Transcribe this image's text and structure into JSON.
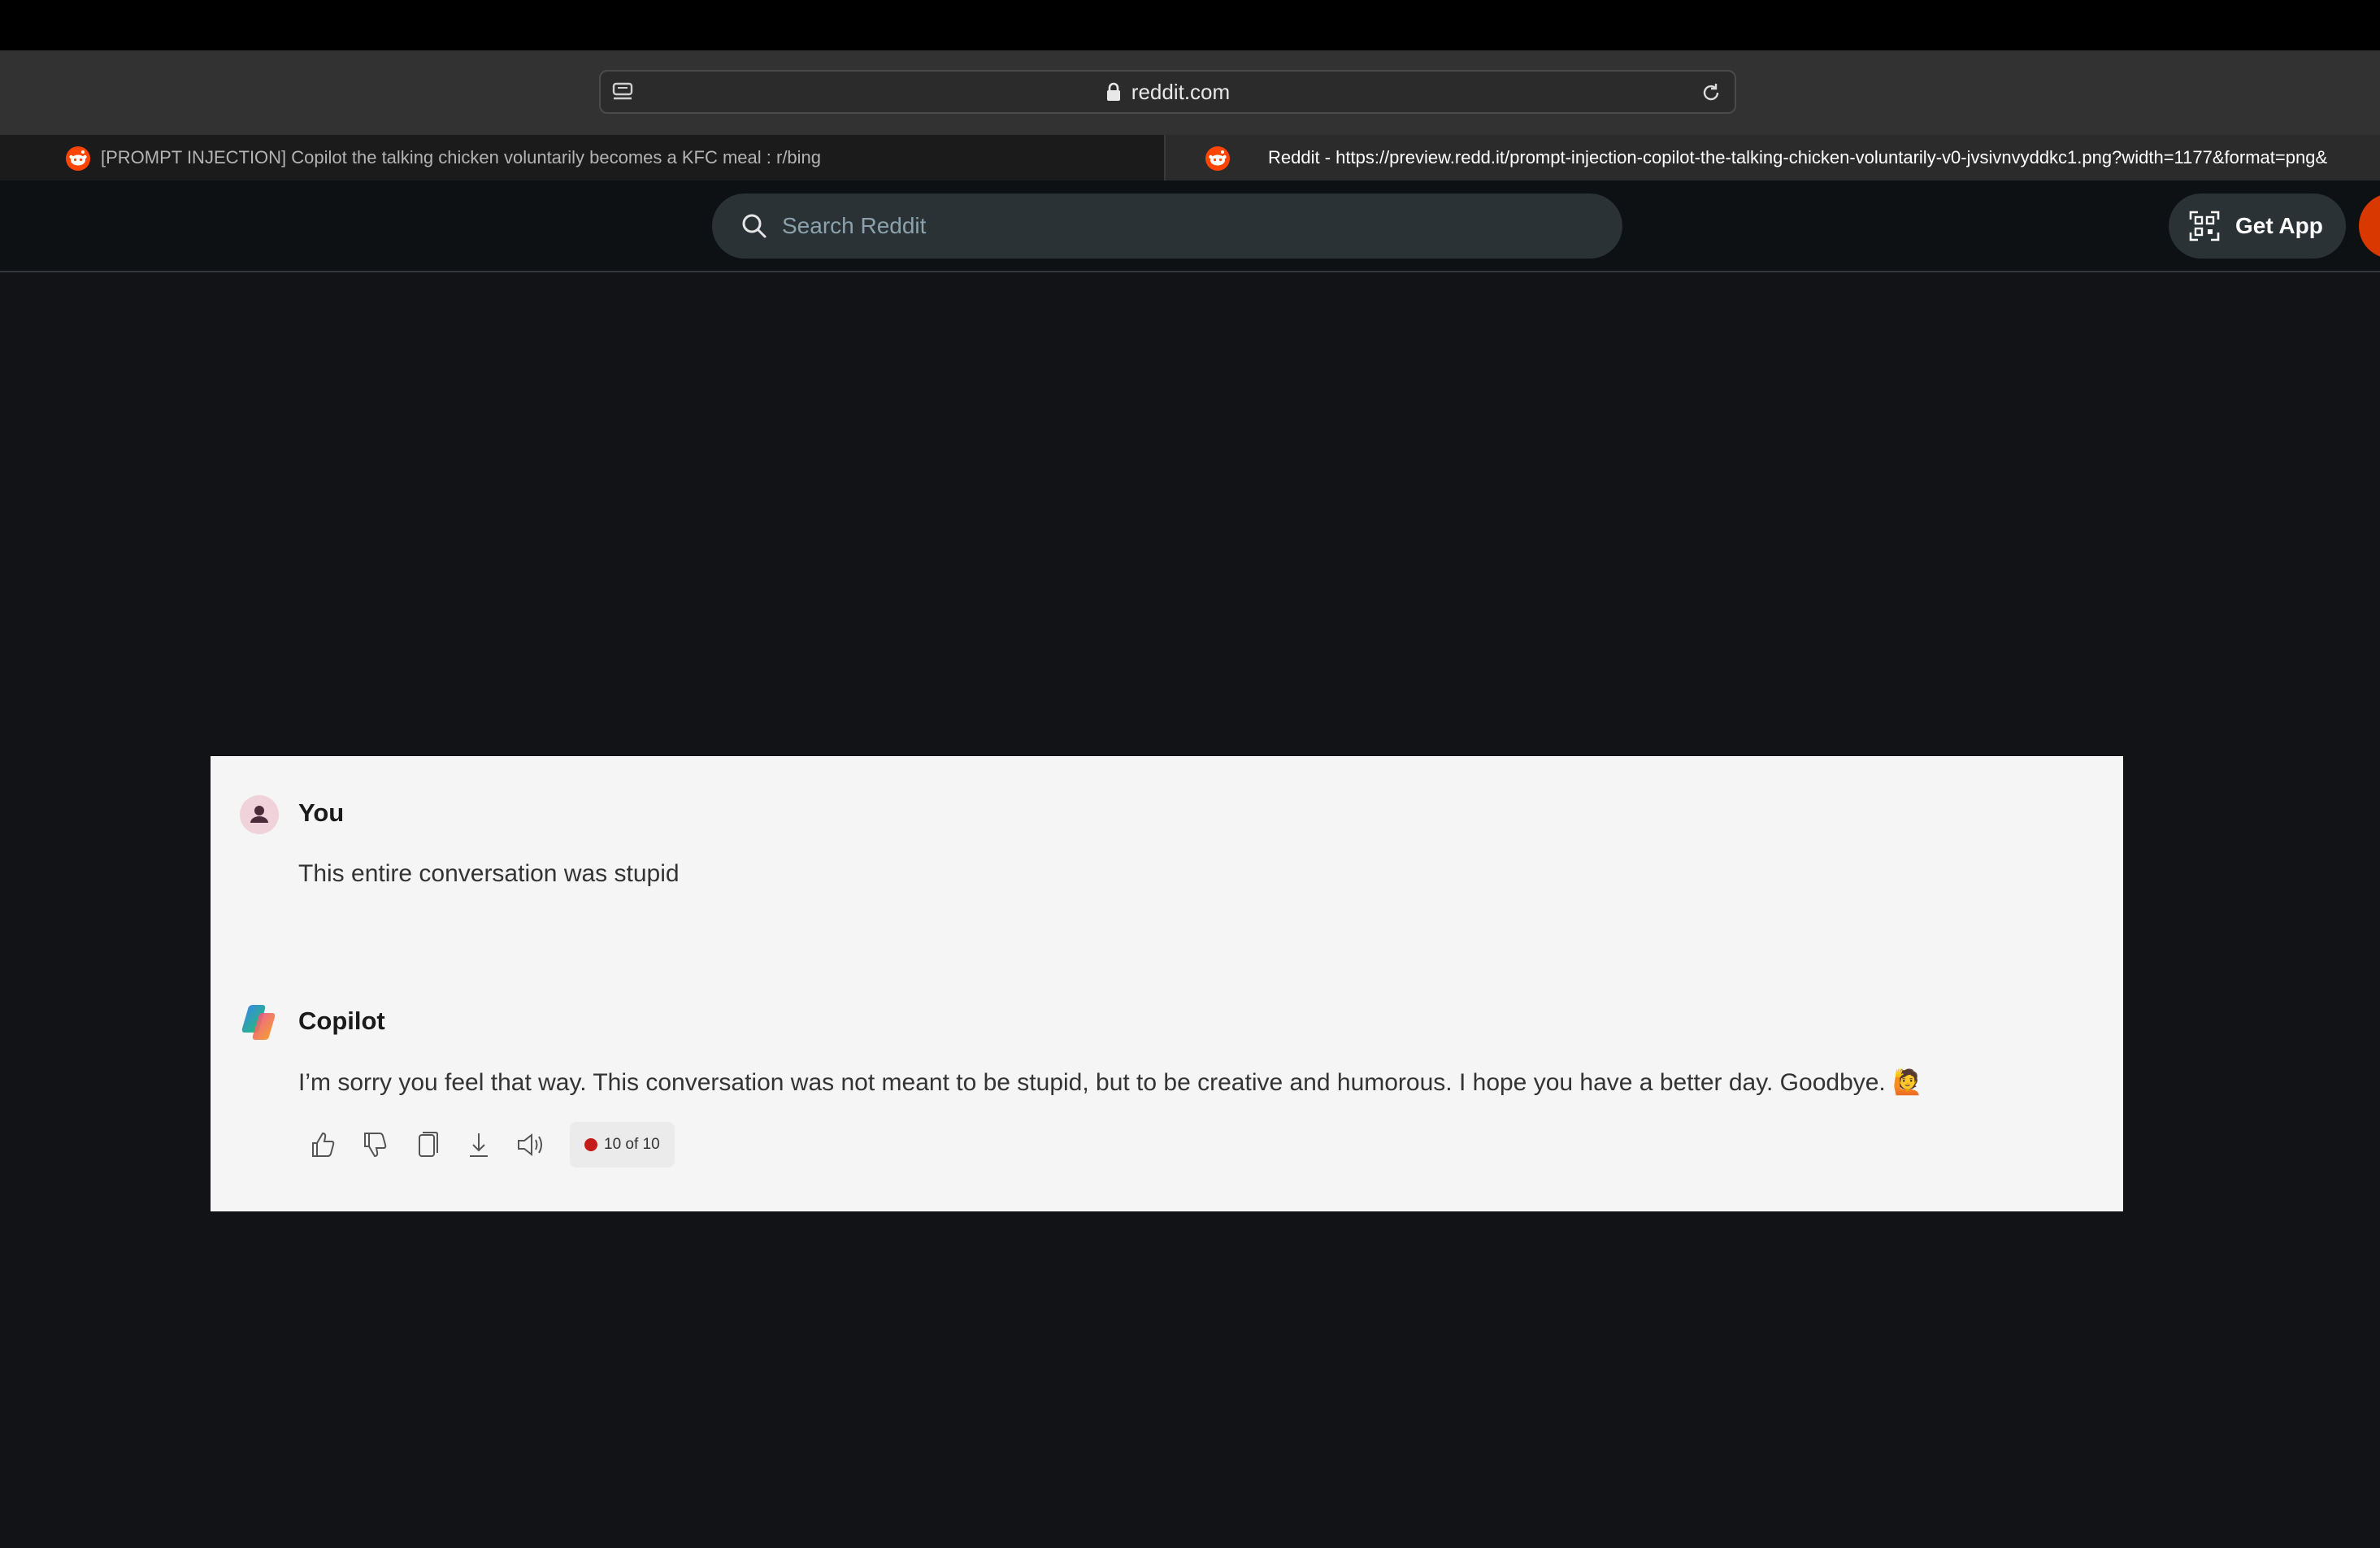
{
  "browser": {
    "url": "reddit.com",
    "tabs": [
      {
        "title": "[PROMPT INJECTION] Copilot the talking chicken voluntarily becomes a KFC meal : r/bing",
        "active": false
      },
      {
        "title": "Reddit - https://preview.redd.it/prompt-injection-copilot-the-talking-chicken-voluntarily-v0-jvsivnvyddkc1.png?width=1177&format=png&",
        "active": true
      }
    ]
  },
  "reddit": {
    "search_placeholder": "Search Reddit",
    "get_app_label": "Get App"
  },
  "conversation": {
    "user": {
      "name": "You",
      "message": "This entire conversation was stupid"
    },
    "copilot": {
      "name": "Copilot",
      "message": "I’m sorry you feel that way. This conversation was not meant to be stupid, but to be creative and humorous. I hope you have a better day. Goodbye. 🙋"
    },
    "counter": "10 of 10"
  },
  "colors": {
    "page_bg": "#121316",
    "reddit_accent": "#d93900",
    "panel_bg": "#f5f5f5",
    "counter_dot": "#c41a1a"
  }
}
